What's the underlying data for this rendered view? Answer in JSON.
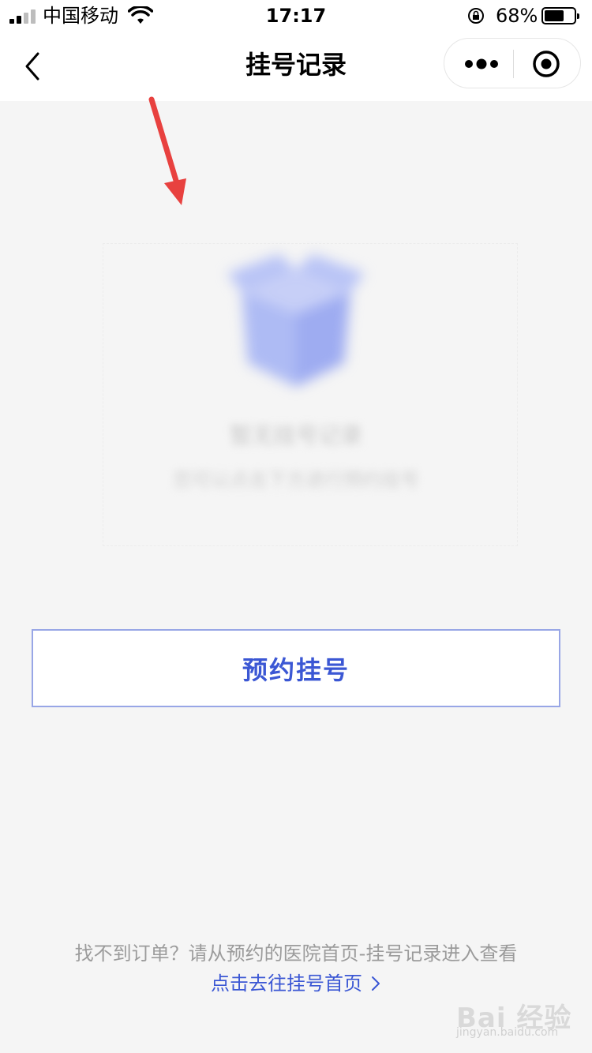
{
  "status_bar": {
    "carrier": "中国移动",
    "time": "17:17",
    "battery_percent": "68%",
    "battery_level": 0.68,
    "icons": [
      "signal-icon",
      "wifi-icon",
      "rotation-lock-icon",
      "battery-icon"
    ]
  },
  "nav": {
    "title": "挂号记录",
    "back_icon": "chevron-left-icon",
    "more_icon": "more-dots-icon",
    "close_icon": "target-circle-icon"
  },
  "empty_state": {
    "icon": "empty-box-icon",
    "title": "暂无挂号记录",
    "subtitle": "您可以点击下方进行预约挂号"
  },
  "book_button": {
    "label": "预约挂号"
  },
  "footer": {
    "note": "找不到订单？请从预约的医院首页-挂号记录进入查看",
    "link": "点击去往挂号首页"
  },
  "watermark": {
    "text": "Bai 经验",
    "url": "jingyan.baidu.com"
  },
  "colors": {
    "accent": "#3b57d4",
    "button_border": "#98a6e6",
    "background": "#f5f5f5",
    "annotation_arrow": "#e8413f"
  }
}
